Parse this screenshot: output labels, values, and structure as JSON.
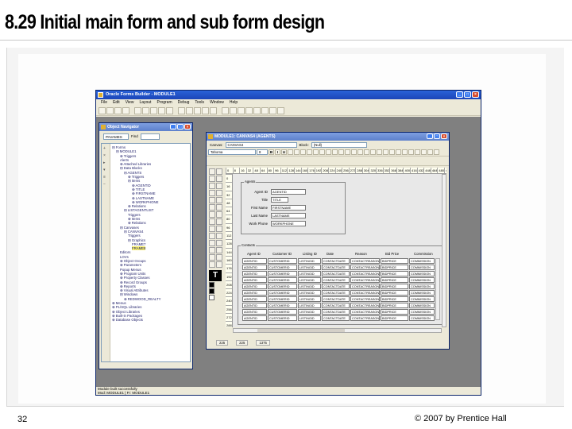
{
  "slide": {
    "title": "8.29 Initial main form and sub form design",
    "page_number": "32",
    "copyright": "© 2007 by Prentice Hall"
  },
  "app": {
    "title": "Oracle Forms Builder - MODULE1",
    "menu": [
      "File",
      "Edit",
      "View",
      "Layout",
      "Program",
      "Debug",
      "Tools",
      "Window",
      "Help"
    ],
    "status": [
      "Module built successfully",
      "Mod: MODULE1 | Fr: MODULE1"
    ]
  },
  "navigator": {
    "title": "Object Navigator",
    "selector": "PAVAMES",
    "find_label": "Find",
    "tree": [
      {
        "indent": 0,
        "text": "⊟ Forms"
      },
      {
        "indent": 1,
        "text": "⊟ MODULE1"
      },
      {
        "indent": 2,
        "text": "⊕ Triggers"
      },
      {
        "indent": 2,
        "text": "Alerts"
      },
      {
        "indent": 2,
        "text": "⊕ Attached Libraries"
      },
      {
        "indent": 2,
        "text": "⊟ Data Blocks"
      },
      {
        "indent": 3,
        "text": "⊟ AGENTS"
      },
      {
        "indent": 4,
        "text": "⊕ Triggers"
      },
      {
        "indent": 4,
        "text": "⊟ Items"
      },
      {
        "indent": 5,
        "text": "⊕ AGENTID"
      },
      {
        "indent": 5,
        "text": "⊕ TITLE"
      },
      {
        "indent": 5,
        "text": "⊕ FIRSTNAME"
      },
      {
        "indent": 5,
        "text": "⊕ LASTNAME"
      },
      {
        "indent": 5,
        "text": "⊕ WORKPHONE"
      },
      {
        "indent": 4,
        "text": "⊕ Relations"
      },
      {
        "indent": 3,
        "text": "⊟ LISTAGENTLIST"
      },
      {
        "indent": 4,
        "text": "Triggers"
      },
      {
        "indent": 4,
        "text": "⊕ Items"
      },
      {
        "indent": 4,
        "text": "⊕ Relations"
      },
      {
        "indent": 2,
        "text": "⊟ Canvases"
      },
      {
        "indent": 3,
        "text": "⊟ CANVAS4"
      },
      {
        "indent": 4,
        "text": "Triggers"
      },
      {
        "indent": 4,
        "text": "⊟ Graphics"
      },
      {
        "indent": 5,
        "text": "FRAME7"
      },
      {
        "indent": 5,
        "text": "FRAME8",
        "highlight": true
      },
      {
        "indent": 2,
        "text": "Editors"
      },
      {
        "indent": 2,
        "text": "LOVs"
      },
      {
        "indent": 2,
        "text": "⊕ Object Groups"
      },
      {
        "indent": 2,
        "text": "⊕ Parameters"
      },
      {
        "indent": 2,
        "text": "Popup Menus"
      },
      {
        "indent": 2,
        "text": "⊕ Program Units"
      },
      {
        "indent": 2,
        "text": "⊕ Property Classes"
      },
      {
        "indent": 2,
        "text": "⊕ Record Groups"
      },
      {
        "indent": 2,
        "text": "⊕ Reports"
      },
      {
        "indent": 2,
        "text": "⊕ Visual Attributes"
      },
      {
        "indent": 2,
        "text": "⊟ Windows"
      },
      {
        "indent": 3,
        "text": "⊕ REDWOOD_REALTY"
      },
      {
        "indent": 0,
        "text": "⊕ Menus"
      },
      {
        "indent": 0,
        "text": "⊕ PL/SQL Libraries"
      },
      {
        "indent": 0,
        "text": "⊕ Object Libraries"
      },
      {
        "indent": 0,
        "text": "⊕ Built-in Packages"
      },
      {
        "indent": 0,
        "text": "⊕ Database Objects"
      }
    ]
  },
  "layout_editor": {
    "title": "MODULE1: CANVAS4 (AGENTS)",
    "canvas_label": "Canvas:",
    "canvas_value": "CANVAS4",
    "block_label": "Block:",
    "block_value": "(Null)",
    "font_value": "Tahoma",
    "font_size": "8",
    "format_buttons": [
      "B",
      "I",
      "U"
    ],
    "ruler_h": [
      "0",
      "8",
      "16",
      "32",
      "48",
      "64",
      "80",
      "96",
      "112",
      "128",
      "144",
      "160",
      "176",
      "192",
      "208",
      "224",
      "240",
      "256",
      "272",
      "288",
      "304",
      "320",
      "336",
      "352",
      "368",
      "384",
      "400",
      "416",
      "432",
      "448",
      "464",
      "480",
      "496",
      "512"
    ],
    "ruler_v": [
      "0",
      "16",
      "32",
      "48",
      "64",
      "80",
      "96",
      "112",
      "128",
      "144",
      "160",
      "176",
      "192",
      "208",
      "224",
      "240",
      "256",
      "272",
      "288"
    ],
    "main_frame": {
      "label": "Agents",
      "fields": [
        {
          "label": "Agent ID",
          "value": "AGENTID"
        },
        {
          "label": "Title",
          "value": "TITLE"
        },
        {
          "label": "First Name",
          "value": "FIRSTNAME"
        },
        {
          "label": "Last Name",
          "value": "LASTNAME"
        },
        {
          "label": "Work Phone",
          "value": "WORKPHONE"
        }
      ]
    },
    "sub_frame": {
      "label": "Contacts",
      "columns": [
        "Agent ID",
        "Customer ID",
        "Listing ID",
        "Date",
        "Reason",
        "Bid Price",
        "Commission"
      ],
      "row_values": [
        "AGENTID",
        "CUSTOMERID",
        "LISTINGID",
        "CONTACTDATE",
        "CONTACTREASON",
        "BIDPRICE",
        "COMMISSION"
      ],
      "row_count": 10
    },
    "status": [
      "225",
      "225",
      "1375"
    ]
  }
}
